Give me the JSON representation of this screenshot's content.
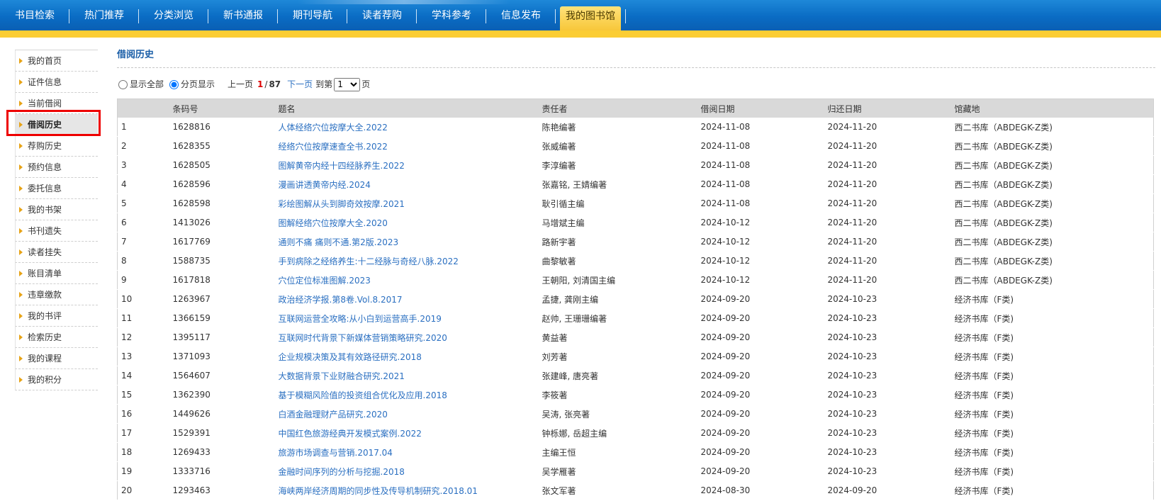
{
  "nav": {
    "items": [
      "书目检索",
      "热门推荐",
      "分类浏览",
      "新书通报",
      "期刊导航",
      "读者荐购",
      "学科参考",
      "信息发布",
      "我的图书馆"
    ],
    "active_index": 8
  },
  "sidebar": {
    "items": [
      "我的首页",
      "证件信息",
      "当前借阅",
      "借阅历史",
      "荐购历史",
      "预约信息",
      "委托信息",
      "我的书架",
      "书刊遗失",
      "读者挂失",
      "账目清单",
      "违章缴款",
      "我的书评",
      "检索历史",
      "我的课程",
      "我的积分"
    ],
    "active_index": 3
  },
  "main": {
    "title": "借阅历史",
    "pager": {
      "show_all_label": "显示全部",
      "paged_label": "分页显示",
      "prev_label": "上一页",
      "current_page": "1",
      "separator": "/",
      "total_pages": "87",
      "next_label": "下一页",
      "goto_prefix": "到第",
      "goto_suffix": "页",
      "selected_page": "1"
    },
    "table": {
      "headers": [
        "",
        "条码号",
        "题名",
        "责任者",
        "借阅日期",
        "归还日期",
        "馆藏地"
      ],
      "rows": [
        [
          "1",
          "1628816",
          "人体经络穴位按摩大全.2022",
          "陈艳编著",
          "2024-11-08",
          "2024-11-20",
          "西二书库（ABDEGK-Z类)"
        ],
        [
          "2",
          "1628355",
          "经络穴位按摩速查全书.2022",
          "张威编著",
          "2024-11-08",
          "2024-11-20",
          "西二书库（ABDEGK-Z类)"
        ],
        [
          "3",
          "1628505",
          "图解黄帝内经十四经脉养生.2022",
          "李淳编著",
          "2024-11-08",
          "2024-11-20",
          "西二书库（ABDEGK-Z类)"
        ],
        [
          "4",
          "1628596",
          "漫画讲透黄帝内经.2024",
          "张嘉铭, 王婧编著",
          "2024-11-08",
          "2024-11-20",
          "西二书库（ABDEGK-Z类)"
        ],
        [
          "5",
          "1628598",
          "彩绘图解从头到脚奇效按摩.2021",
          "耿引循主编",
          "2024-11-08",
          "2024-11-20",
          "西二书库（ABDEGK-Z类)"
        ],
        [
          "6",
          "1413026",
          "图解经络穴位按摩大全.2020",
          "马增斌主编",
          "2024-10-12",
          "2024-11-20",
          "西二书库（ABDEGK-Z类)"
        ],
        [
          "7",
          "1617769",
          "通则不痛 痛则不通.第2版.2023",
          "路新宇著",
          "2024-10-12",
          "2024-11-20",
          "西二书库（ABDEGK-Z类)"
        ],
        [
          "8",
          "1588735",
          "手到病除之经络养生:十二经脉与奇经八脉.2022",
          "曲黎敏著",
          "2024-10-12",
          "2024-11-20",
          "西二书库（ABDEGK-Z类)"
        ],
        [
          "9",
          "1617818",
          "穴位定位标准图解.2023",
          "王朝阳, 刘清国主编",
          "2024-10-12",
          "2024-11-20",
          "西二书库（ABDEGK-Z类)"
        ],
        [
          "10",
          "1263967",
          "政治经济学报.第8卷.Vol.8.2017",
          "孟捷, 龚刚主编",
          "2024-09-20",
          "2024-10-23",
          "经济书库（F类)"
        ],
        [
          "11",
          "1366159",
          "互联网运营全攻略:从小白到运营高手.2019",
          "赵帅, 王珊珊编著",
          "2024-09-20",
          "2024-10-23",
          "经济书库（F类)"
        ],
        [
          "12",
          "1395117",
          "互联网时代背景下新媒体营销策略研究.2020",
          "黄益著",
          "2024-09-20",
          "2024-10-23",
          "经济书库（F类)"
        ],
        [
          "13",
          "1371093",
          "企业规模决策及其有效路径研究.2018",
          "刘芳著",
          "2024-09-20",
          "2024-10-23",
          "经济书库（F类)"
        ],
        [
          "14",
          "1564607",
          "大数据背景下业财融合研究.2021",
          "张建峰, 唐亮著",
          "2024-09-20",
          "2024-10-23",
          "经济书库（F类)"
        ],
        [
          "15",
          "1362390",
          "基于模糊风险值的投资组合优化及应用.2018",
          "李筱著",
          "2024-09-20",
          "2024-10-23",
          "经济书库（F类)"
        ],
        [
          "16",
          "1449626",
          "白酒金融理财产品研究.2020",
          "吴涛, 张亮著",
          "2024-09-20",
          "2024-10-23",
          "经济书库（F类)"
        ],
        [
          "17",
          "1529391",
          "中国红色旅游经典开发模式案例.2022",
          "钟栎娜, 岳超主编",
          "2024-09-20",
          "2024-10-23",
          "经济书库（F类)"
        ],
        [
          "18",
          "1269433",
          "旅游市场调查与营销.2017.04",
          "主编王恒",
          "2024-09-20",
          "2024-10-23",
          "经济书库（F类)"
        ],
        [
          "19",
          "1333716",
          "金融时间序列的分析与挖掘.2018",
          "吴学雁著",
          "2024-09-20",
          "2024-10-23",
          "经济书库（F类)"
        ],
        [
          "20",
          "1293463",
          "海峡两岸经济周期的同步性及传导机制研究.2018.01",
          "张文军著",
          "2024-08-30",
          "2024-09-20",
          "经济书库（F类)"
        ]
      ]
    }
  },
  "colors": {
    "nav_blue": "#0a6cc4",
    "nav_yellow": "#fbcd34",
    "link_blue": "#2a6fc1",
    "title_blue": "#1b5fa8",
    "current_page_red": "#dd0000",
    "highlight_red": "#ee0000"
  }
}
